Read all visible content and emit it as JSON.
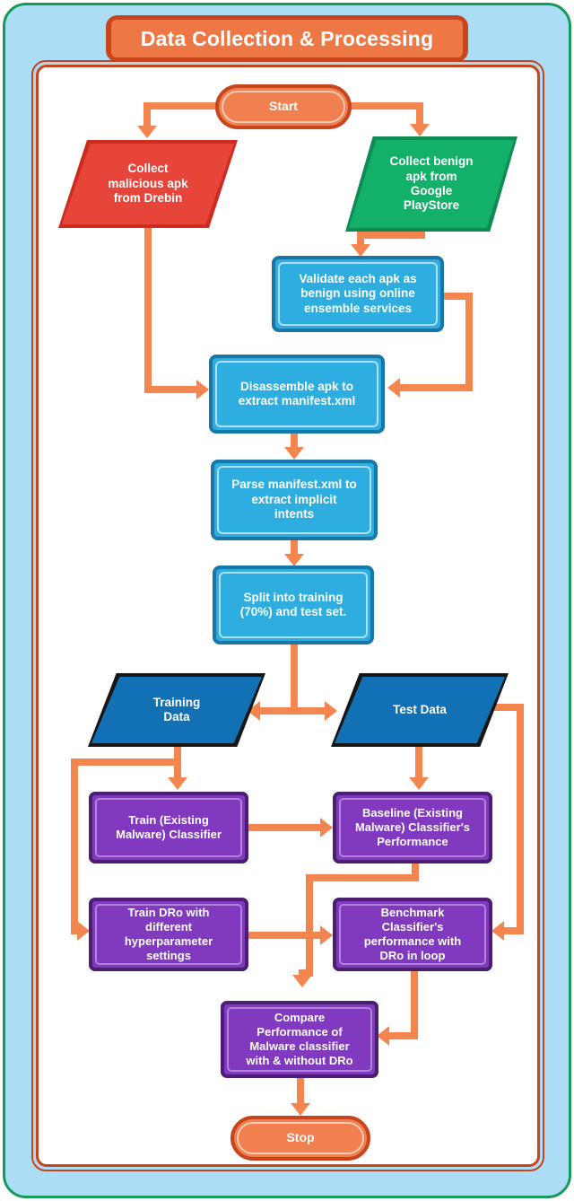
{
  "diagram": {
    "title": "Data Collection & Processing",
    "colors": {
      "accent_orange": "#F4854F",
      "frame_orange": "#C8441B",
      "outer_green": "#159B55",
      "background_blue": "#ABDDF6",
      "node_red": "#E8453A",
      "node_green": "#13B06A",
      "node_lightblue": "#2EAEE0",
      "node_navy": "#1271B5",
      "node_purple": "#8039BF",
      "terminator_orange": "#F08050"
    },
    "nodes": {
      "start": "Start",
      "collect_malicious": "Collect\nmalicious apk\nfrom Drebin",
      "collect_benign": "Collect benign\napk from\nGoogle\nPlayStore",
      "validate": "Validate each apk as\nbenign using online\nensemble services",
      "disassemble": "Disassemble apk to\nextract manifest.xml",
      "parse": "Parse manifest.xml to\nextract implicit\nintents",
      "split": "Split into training\n(70%) and test set.",
      "training_data": "Training\nData",
      "test_data": "Test Data",
      "train_existing": "Train (Existing\nMalware) Classifier",
      "baseline": "Baseline (Existing\nMalware) Classifier's\nPerformance",
      "train_dro": "Train DRo with\ndifferent\nhyperparameter\nsettings",
      "benchmark": "Benchmark\nClassifier's\nperformance with\nDRo in loop",
      "compare": "Compare\nPerformance of\nMalware classifier\nwith & without DRo",
      "stop": "Stop"
    }
  }
}
